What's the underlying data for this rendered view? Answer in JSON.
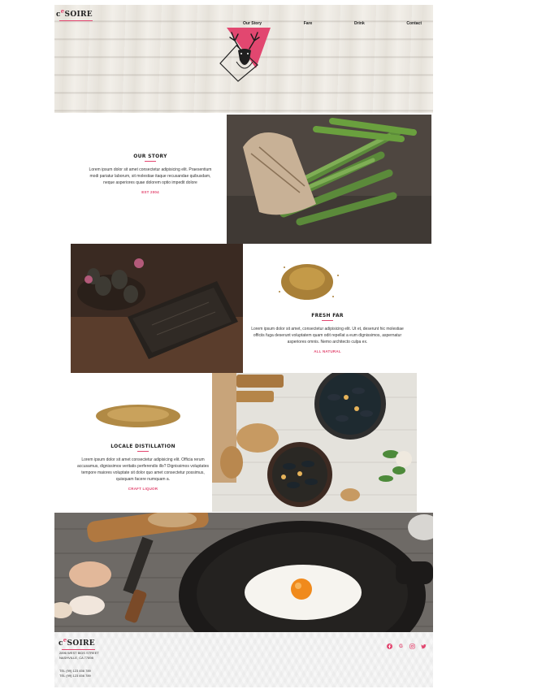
{
  "brand": {
    "logo_letter": "c",
    "logo_accent": "e",
    "logo_rest": "SOIRE"
  },
  "nav": {
    "items": [
      "Our Story",
      "Fare",
      "Drink",
      "Contact"
    ]
  },
  "sections": {
    "story": {
      "title": "OUR STORY",
      "body": "Lorem ipsum dolor sit amet consectetur adipisicing elit. Praesentium modi pariatur laborum, sit molestiae itaque recusandae quibusdam, neque asperiores quae dolorem optio impedit dolore",
      "tag": "EST 2004"
    },
    "fare": {
      "title": "FRESH FAR",
      "body": "Lorem ipsum dolor sit amet, consectetur adipisicing elit. Ut et, deserunt hic molestiae officiis fuga deserunt voluptatem quam odit repellat a eum dignissimos, aspernatur asperiores omnis. Nemo architecto culpa ex.",
      "tag": "ALL NATURAL"
    },
    "distillation": {
      "title": "LOCALE DISTILLATION",
      "body": "Lorem ipsum dolor sit amet consectetur adipisicing elit. Officia rerum accusamus, dignissimos veritatis perferendis illo? Dignissimos voluptates tempore maiores voluptate sit dolor quo amet consectetur possimus, quisquam facere numquam a.",
      "tag": "CRAFT LIQUOR"
    }
  },
  "footer": {
    "address_line1": "2896 WEST BIDS STREET",
    "address_line2": "NASHVILLE, CA 77898",
    "tel1": "TEL (99) 123 456 789",
    "tel2": "TEL (99) 123 456 789"
  },
  "social": [
    "facebook-icon",
    "google-icon",
    "instagram-icon",
    "twitter-icon"
  ],
  "colors": {
    "accent": "#e24770",
    "text": "#222222"
  }
}
